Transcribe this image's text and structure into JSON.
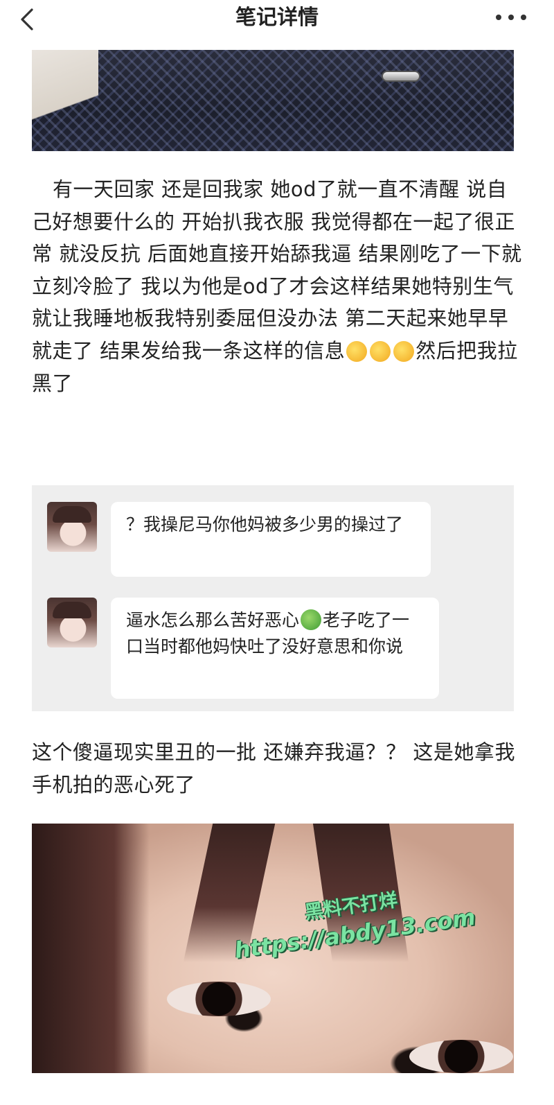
{
  "header": {
    "title": "笔记详情",
    "back_icon": "chevron-left-icon",
    "more_icon": "more-horizontal-icon"
  },
  "post": {
    "paragraph_1_before_emoji": "有一天回家 还是回我家 她od了就一直不清醒 说自己好想要什么的 开始扒我衣服 我觉得都在一起了很正常 就没反抗 后面她直接开始舔我逼 结果刚吃了一下就立刻冷脸了 我以为他是od了才会这样结果她特别生气就让我睡地板我特别委屈但没办法 第二天起来她早早就走了 结果发给我一条这样的信息",
    "paragraph_1_after_emoji": "然后把我拉黑了",
    "paragraph_1_emojis": [
      "rolling-on-floor-laughing-emoji",
      "rolling-on-floor-laughing-emoji",
      "rolling-on-floor-laughing-emoji"
    ],
    "paragraph_2": "这个傻逼现实里丑的一批 还嫌弃我逼？？ 这是她拿我手机拍的恶心死了"
  },
  "chat": {
    "messages": [
      {
        "text": "？我操尼马你他妈被多少男的操过了"
      },
      {
        "text_before_emoji": "逼水怎么那么苦好恶心",
        "emoji": "nauseated-face-emoji",
        "text_after_emoji": "老子吃了一口当时都他妈快吐了没好意思和你说"
      }
    ]
  },
  "watermark": {
    "line_1": "黑料不打烊",
    "line_2": "https://abdy13.com",
    "color": "#7be3a2"
  }
}
